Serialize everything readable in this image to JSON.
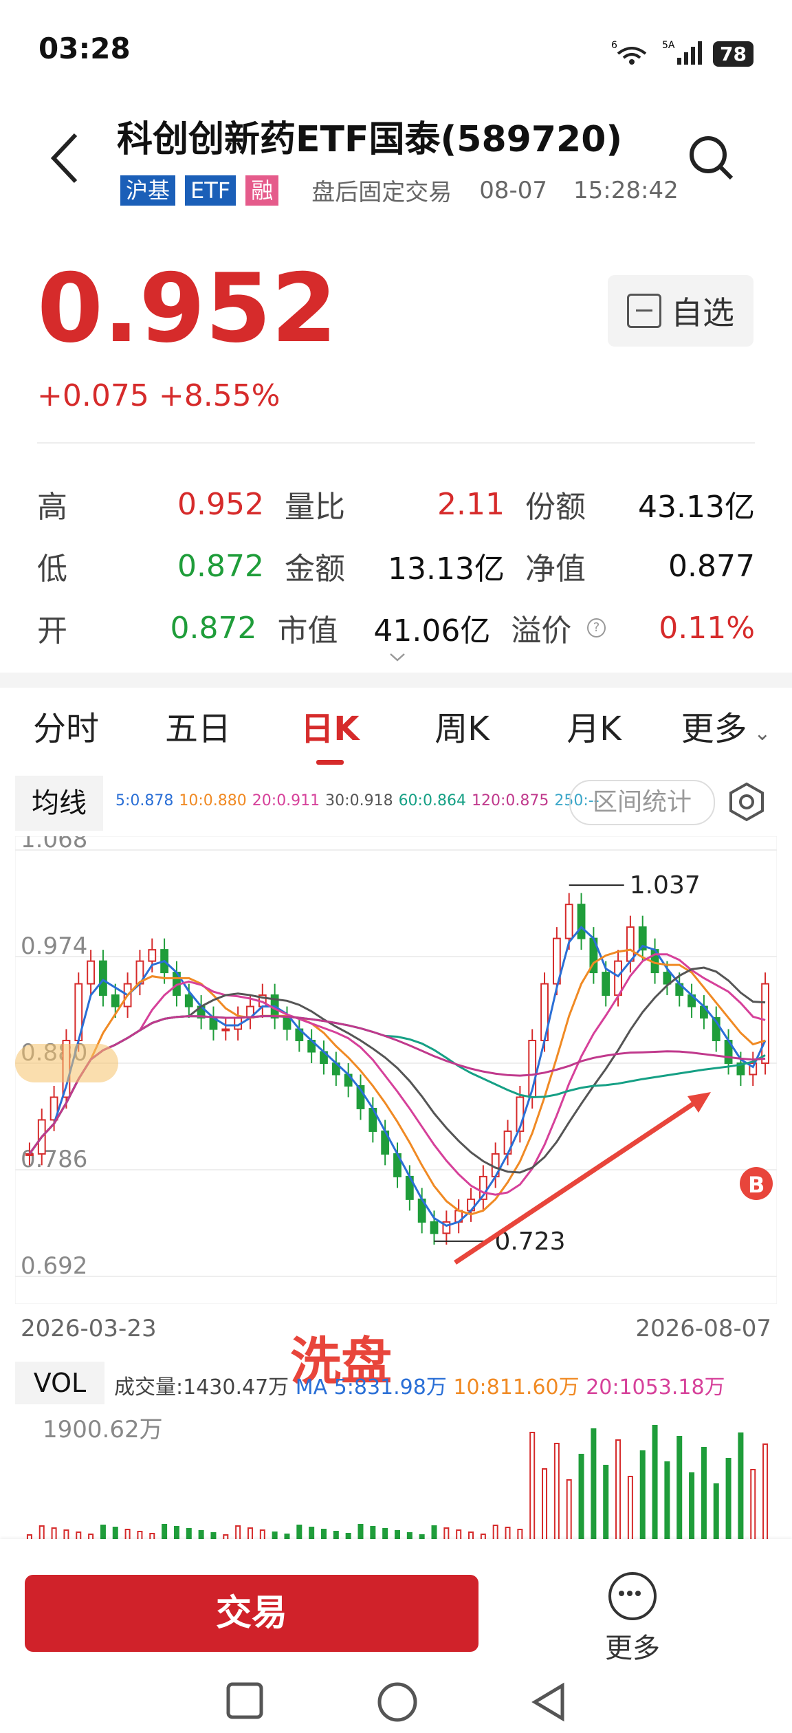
{
  "status": {
    "time": "03:28",
    "network_left": "6",
    "network_right": "5A",
    "battery": "78"
  },
  "header": {
    "title": "科创创新药ETF国泰(589720)",
    "tags": [
      "沪基",
      "ETF",
      "融"
    ],
    "trade_mode": "盘后固定交易",
    "date": "08-07",
    "time": "15:28:42"
  },
  "quote": {
    "price": "0.952",
    "change": "+0.075",
    "change_pct": "+8.55%",
    "watch_label": "自选"
  },
  "stats": [
    [
      {
        "label": "高",
        "value": "0.952",
        "color": "red"
      },
      {
        "label": "量比",
        "value": "2.11",
        "color": "red"
      },
      {
        "label": "份额",
        "value": "43.13亿",
        "color": "black"
      }
    ],
    [
      {
        "label": "低",
        "value": "0.872",
        "color": "green"
      },
      {
        "label": "金额",
        "value": "13.13亿",
        "color": "black"
      },
      {
        "label": "净值",
        "value": "0.877",
        "color": "black"
      }
    ],
    [
      {
        "label": "开",
        "value": "0.872",
        "color": "green"
      },
      {
        "label": "市值",
        "value": "41.06亿",
        "color": "black"
      },
      {
        "label": "溢价",
        "value": "0.11%",
        "color": "red"
      }
    ]
  ],
  "tabs": [
    "分时",
    "五日",
    "日K",
    "周K",
    "月K",
    "更多"
  ],
  "active_tab": "日K",
  "ma_panel": {
    "label": "均线",
    "values": [
      {
        "text": "5:0.878",
        "color": "#2a6fd6"
      },
      {
        "text": "10:0.880",
        "color": "#f08a24"
      },
      {
        "text": "20:0.911",
        "color": "#d6419a"
      },
      {
        "text": "30:0.918",
        "color": "#555555"
      },
      {
        "text": "60:0.864",
        "color": "#16a085"
      },
      {
        "text": "120:0.875",
        "color": "#c0398c"
      },
      {
        "text": "250:--",
        "color": "#3aa6c8"
      }
    ],
    "range_button": "区间统计"
  },
  "chart_data": {
    "type": "candlestick",
    "y_ticks": [
      "1.068",
      "0.974",
      "0.880",
      "0.786",
      "0.692"
    ],
    "ylim": [
      0.692,
      1.068
    ],
    "x_start": "2026-03-23",
    "x_end": "2026-08-07",
    "max_label": "1.037",
    "min_label": "0.723",
    "closes": [
      0.8,
      0.83,
      0.85,
      0.9,
      0.95,
      0.97,
      0.94,
      0.93,
      0.95,
      0.97,
      0.98,
      0.96,
      0.94,
      0.93,
      0.92,
      0.91,
      0.91,
      0.92,
      0.93,
      0.94,
      0.92,
      0.91,
      0.9,
      0.89,
      0.88,
      0.87,
      0.86,
      0.84,
      0.82,
      0.8,
      0.78,
      0.76,
      0.74,
      0.73,
      0.74,
      0.75,
      0.76,
      0.78,
      0.8,
      0.82,
      0.85,
      0.9,
      0.95,
      0.99,
      1.02,
      0.99,
      0.96,
      0.94,
      0.97,
      1.0,
      0.98,
      0.96,
      0.95,
      0.94,
      0.93,
      0.92,
      0.9,
      0.88,
      0.87,
      0.88,
      0.95
    ]
  },
  "annotation": "洗盘",
  "buy_marker": "B",
  "vol_panel": {
    "label": "VOL",
    "volume": "成交量:1430.47万",
    "ma5": "MA 5:831.98万",
    "ma10": "10:811.60万",
    "ma20": "20:1053.18万",
    "max_label": "1900.62万"
  },
  "bottom": {
    "trade": "交易",
    "more": "更多"
  }
}
